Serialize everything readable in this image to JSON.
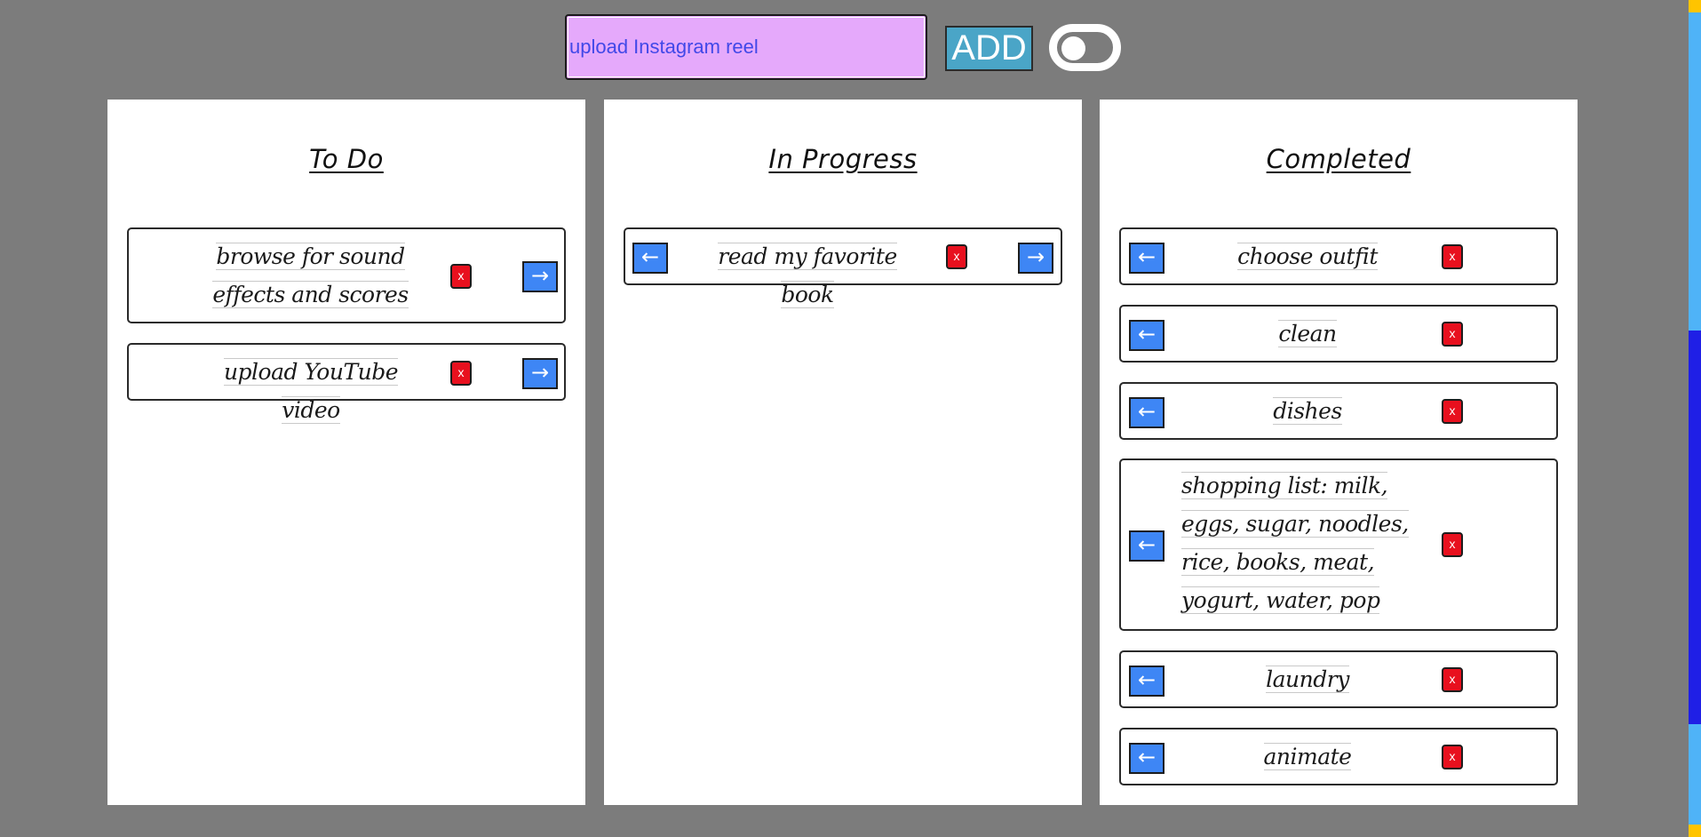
{
  "input": {
    "value": "upload Instagram reel"
  },
  "add_button": {
    "label": "ADD"
  },
  "columns": [
    {
      "title": "To Do",
      "cards": [
        {
          "text": "browse for sound effects and scores",
          "delete_label": "x",
          "forward_arrow": "→"
        },
        {
          "text": "upload YouTube video",
          "delete_label": "x",
          "forward_arrow": "→"
        }
      ]
    },
    {
      "title": "In Progress",
      "cards": [
        {
          "text": "read my favorite book",
          "back_arrow": "←",
          "delete_label": "x",
          "forward_arrow": "→"
        }
      ]
    },
    {
      "title": "Completed",
      "cards": [
        {
          "text": "choose outfit",
          "back_arrow": "←",
          "delete_label": "x"
        },
        {
          "text": "clean",
          "back_arrow": "←",
          "delete_label": "x"
        },
        {
          "text": "dishes",
          "back_arrow": "←",
          "delete_label": "x"
        },
        {
          "text": "shopping list: milk, eggs, sugar, noodles, rice, books, meat, yogurt, water, pop",
          "back_arrow": "←",
          "delete_label": "x"
        },
        {
          "text": "laundry",
          "back_arrow": "←",
          "delete_label": "x"
        },
        {
          "text": "animate",
          "back_arrow": "←",
          "delete_label": "x"
        }
      ]
    }
  ],
  "colors": {
    "background": "#7c7c7c",
    "input_bg": "#e5a9fb",
    "input_text": "#4148e8",
    "add_button": "#4aa5c7",
    "arrow_button": "#3e86f5",
    "delete_button": "#e8101e"
  }
}
